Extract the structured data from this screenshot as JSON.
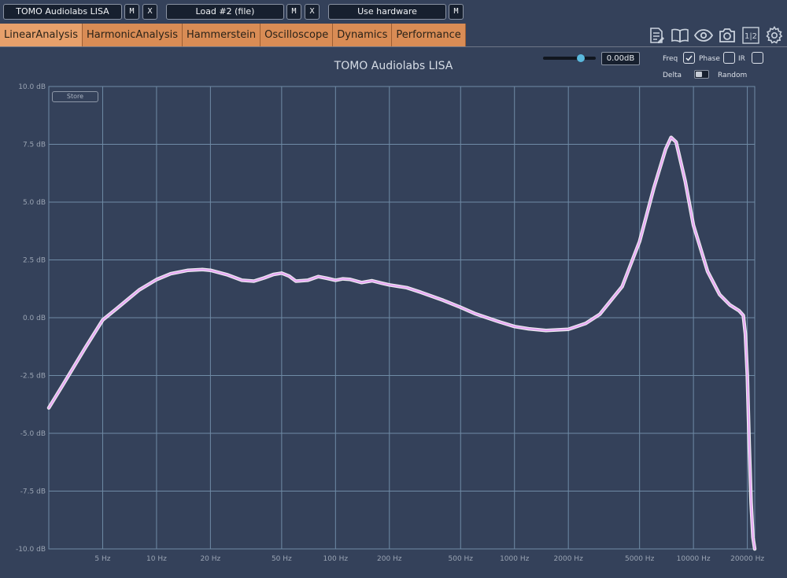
{
  "topbar": {
    "device_name": "TOMO Audiolabs LISA",
    "device_m": "M",
    "device_x": "X",
    "load_label": "Load #2 (file)",
    "load_m": "M",
    "load_x": "X",
    "hardware_label": "Use hardware",
    "hardware_m": "M"
  },
  "tabs": [
    {
      "label": "LinearAnalysis",
      "active": true
    },
    {
      "label": "HarmonicAnalysis",
      "active": false
    },
    {
      "label": "Hammerstein",
      "active": false
    },
    {
      "label": "Oscilloscope",
      "active": false
    },
    {
      "label": "Dynamics",
      "active": false
    },
    {
      "label": "Performance",
      "active": false
    }
  ],
  "toolbar": {
    "icons": [
      "notes-icon",
      "book-icon",
      "eye-icon",
      "camera-icon",
      "split-view-icon",
      "gear-icon"
    ],
    "split_text": "1|2"
  },
  "controls": {
    "gain_value": "0.00dB",
    "gain_level": 0.72,
    "freq_label": "Freq",
    "freq_checked": true,
    "phase_label": "Phase",
    "phase_checked": false,
    "ir_label": "IR",
    "ir_checked": false,
    "delta_label": "Delta",
    "delta_on": false,
    "random_label": "Random",
    "store_label": "Store"
  },
  "colors": {
    "background": "#34415a",
    "grid": "#6f8ba6",
    "curve": "#e8a8f5",
    "tab": "#d98c55"
  },
  "chart_data": {
    "type": "line",
    "title": "TOMO Audiolabs LISA",
    "x_scale": "log",
    "xlim": [
      2.5,
      22000
    ],
    "ylim": [
      -10,
      10
    ],
    "y_ticks": [
      10,
      7.5,
      5,
      2.5,
      0,
      -2.5,
      -5,
      -7.5,
      -10
    ],
    "y_tick_labels": [
      "10.0 dB",
      "7.5 dB",
      "5.0 dB",
      "2.5 dB",
      "0.0 dB",
      "-2.5 dB",
      "-5.0 dB",
      "-7.5 dB",
      "-10.0 dB"
    ],
    "x_ticks": [
      5,
      10,
      20,
      50,
      100,
      200,
      500,
      1000,
      2000,
      5000,
      10000,
      20000
    ],
    "x_tick_labels": [
      "5 Hz",
      "10 Hz",
      "20 Hz",
      "50 Hz",
      "100 Hz",
      "200 Hz",
      "500 Hz",
      "1000 Hz",
      "2000 Hz",
      "5000 Hz",
      "10000 Hz",
      "20000 Hz"
    ],
    "grid": true,
    "series": [
      {
        "x": [
          2.5,
          3,
          4,
          5,
          6,
          8,
          10,
          12,
          15,
          18,
          20,
          25,
          30,
          35,
          40,
          45,
          50,
          55,
          60,
          70,
          80,
          90,
          100,
          110,
          120,
          140,
          160,
          180,
          200,
          250,
          300,
          400,
          500,
          600,
          800,
          1000,
          1200,
          1500,
          2000,
          2500,
          3000,
          4000,
          5000,
          6000,
          7000,
          7500,
          8000,
          9000,
          10000,
          12000,
          14000,
          16000,
          18000,
          19000,
          19500,
          20000,
          20500,
          21000,
          21500,
          22000
        ],
        "y": [
          -3.9,
          -2.9,
          -1.3,
          -0.1,
          0.4,
          1.2,
          1.65,
          1.9,
          2.05,
          2.08,
          2.05,
          1.85,
          1.62,
          1.58,
          1.72,
          1.87,
          1.93,
          1.8,
          1.58,
          1.62,
          1.78,
          1.7,
          1.62,
          1.68,
          1.66,
          1.52,
          1.6,
          1.5,
          1.42,
          1.3,
          1.1,
          0.75,
          0.45,
          0.18,
          -0.15,
          -0.38,
          -0.48,
          -0.55,
          -0.5,
          -0.25,
          0.15,
          1.35,
          3.3,
          5.6,
          7.3,
          7.8,
          7.6,
          5.9,
          4.0,
          2.0,
          1.0,
          0.55,
          0.3,
          0.1,
          -0.7,
          -2.5,
          -5.5,
          -8.0,
          -9.5,
          -10.0
        ]
      }
    ]
  }
}
